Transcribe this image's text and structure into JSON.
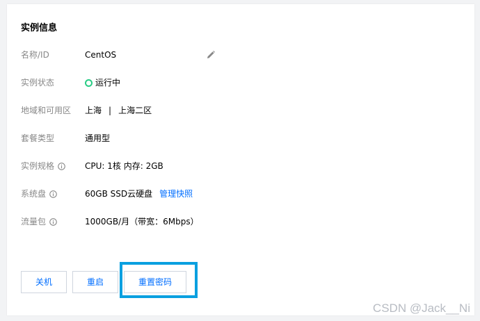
{
  "card": {
    "title": "实例信息",
    "rows": [
      {
        "label": "名称/ID",
        "value": "CentOS"
      },
      {
        "label": "实例状态",
        "value": "运行中"
      },
      {
        "label": "地域和可用区",
        "region": "上海",
        "separator": "|",
        "zone": "上海二区"
      },
      {
        "label": "套餐类型",
        "value": "通用型"
      },
      {
        "label": "实例规格",
        "value": "CPU: 1核 内存: 2GB"
      },
      {
        "label": "系统盘",
        "value": "60GB SSD云硬盘",
        "link": "管理快照"
      },
      {
        "label": "流量包",
        "value": "1000GB/月（带宽：6Mbps）"
      }
    ]
  },
  "buttons": {
    "shutdown": "关机",
    "restart": "重启",
    "reset_password": "重置密码"
  },
  "watermark": "CSDN @Jack__Ni",
  "colors": {
    "accent": "#006eff",
    "status_running": "#29cc85",
    "highlight": "#0aa0e0"
  }
}
